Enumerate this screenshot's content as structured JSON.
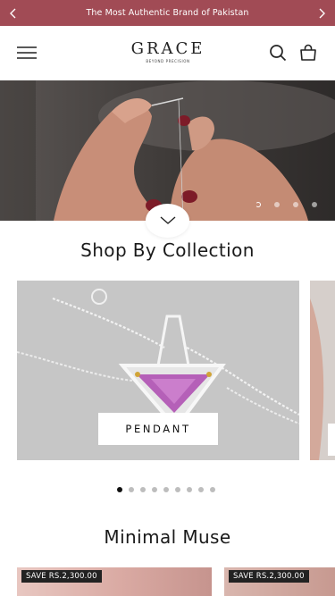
{
  "announcement": {
    "text": "The Most Authentic Brand of Pakistan",
    "bg_color": "#a14b55"
  },
  "header": {
    "logo_text": "GRACE",
    "logo_tagline": "BEYOND PRECISION"
  },
  "hero": {
    "slide_count": 4,
    "active_slide": 1
  },
  "collection_section": {
    "title": "Shop By Collection",
    "card_label": "PENDANT",
    "dot_count": 9,
    "active_dot": 1
  },
  "featured_section": {
    "title": "Minimal Muse",
    "products": [
      {
        "badge": "SAVE RS.2,300.00"
      },
      {
        "badge": "SAVE RS.2,300.00"
      }
    ]
  }
}
